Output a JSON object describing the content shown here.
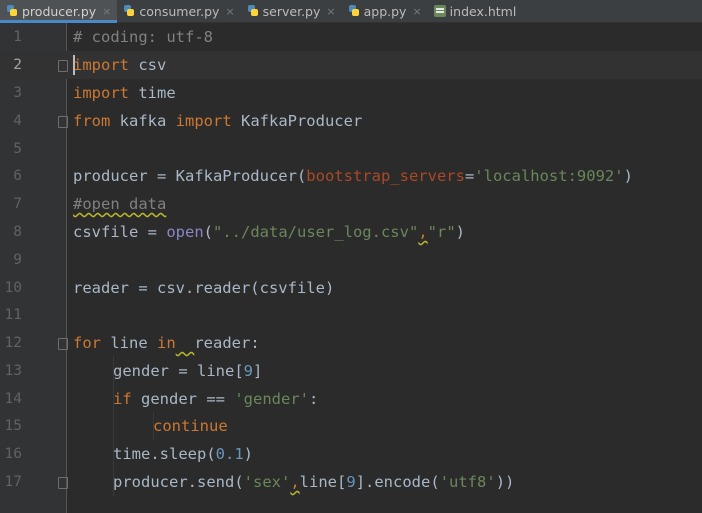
{
  "tabs": [
    {
      "label": "producer.py",
      "icon": "python-file-icon",
      "active": true
    },
    {
      "label": "consumer.py",
      "icon": "python-file-icon",
      "active": false
    },
    {
      "label": "server.py",
      "icon": "python-file-icon",
      "active": false
    },
    {
      "label": "app.py",
      "icon": "python-file-icon",
      "active": false
    },
    {
      "label": "index.html",
      "icon": "html-file-icon",
      "active": false
    }
  ],
  "close_glyph": "×",
  "editor": {
    "line_numbers": [
      "1",
      "2",
      "3",
      "4",
      "5",
      "6",
      "7",
      "8",
      "9",
      "10",
      "11",
      "12",
      "13",
      "14",
      "15",
      "16",
      "17"
    ],
    "current_line": 2,
    "code": {
      "l1": "# coding: utf-8",
      "l2_kw": "import",
      "l2_rest": " csv",
      "l3_kw": "import",
      "l3_rest": " time",
      "l4_kw1": "from",
      "l4_mod": " kafka ",
      "l4_kw2": "import",
      "l4_rest": " KafkaProducer",
      "l6_a": "producer = KafkaProducer(",
      "l6_param": "bootstrap_servers",
      "l6_eq": "=",
      "l6_str": "'localhost:9092'",
      "l6_end": ")",
      "l7": "#open data",
      "l8_a": "csvfile = ",
      "l8_fn": "open",
      "l8_b": "(",
      "l8_str1": "\"../data/user_log.csv\"",
      "l8_comma": ",",
      "l8_str2": "\"r\"",
      "l8_end": ")",
      "l10": "reader = csv.reader(csvfile)",
      "l12_kw": "for",
      "l12_a": " line ",
      "l12_kw2": "in",
      "l12_gap": "  ",
      "l12_b": "reader:",
      "l13_a": "gender = line[",
      "l13_num": "9",
      "l13_b": "]",
      "l14_kw": "if",
      "l14_a": " gender == ",
      "l14_str": "'gender'",
      "l14_b": ":",
      "l15_kw": "continue",
      "l16_a": "time.sleep(",
      "l16_num": "0.1",
      "l16_b": ")",
      "l17_a": "producer.send(",
      "l17_str1": "'sex'",
      "l17_comma": ",",
      "l17_b": "line[",
      "l17_num": "9",
      "l17_c": "].encode(",
      "l17_str2": "'utf8'",
      "l17_end": "))"
    }
  },
  "colors": {
    "background": "#2b2b2b",
    "keyword": "#cc7832",
    "string": "#6a8759",
    "number": "#6897bb",
    "comment": "#808080",
    "parameter": "#aa4926",
    "builtin": "#8888c6",
    "text": "#a9b7c6",
    "tab_underline": "#4a88c7"
  }
}
